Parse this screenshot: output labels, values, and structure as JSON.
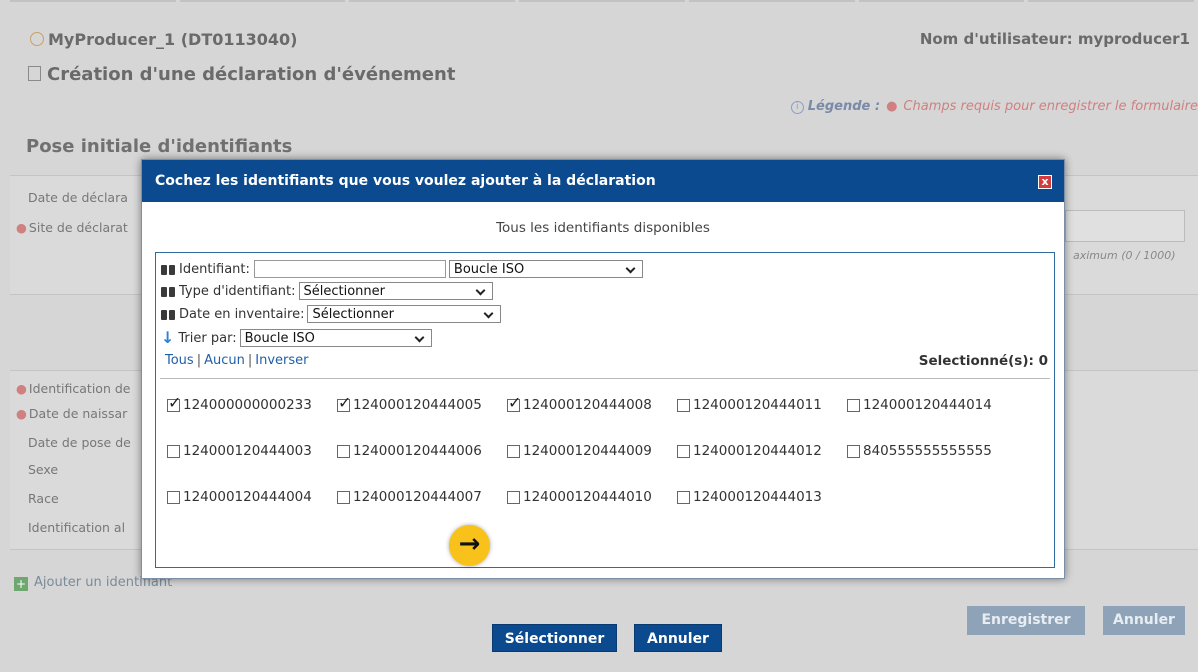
{
  "header": {
    "producer": "MyProducer_1 (DT0113040)",
    "username": "Nom d'utilisateur: myproducer1",
    "page_title": "Création d'une déclaration d'événement",
    "legend_label": "Légende :",
    "legend_dot": "●",
    "legend_text": "Champs requis pour enregistrer le formulaire"
  },
  "form": {
    "section_title": "Pose initiale d'identifiants",
    "labels": [
      "Date de déclara",
      "Site de déclarat",
      "Identification de",
      "Date de naissar",
      "Date de pose de",
      "Sexe",
      "Race",
      "Identification al"
    ],
    "counter": "aximum (0 / 1000)",
    "add_identifier": "Ajouter un identifiant",
    "save_label": "Enregistrer",
    "cancel_label": "Annuler"
  },
  "modal": {
    "title": "Cochez les identifiants que vous voulez ajouter à la déclaration",
    "close_label": "x",
    "subtitle": "Tous les identifiants disponibles",
    "filters": {
      "identifiant_label": "Identifiant:",
      "identifiant_value": "",
      "identifiant_type_select": "Boucle ISO",
      "type_label": "Type d'identifiant:",
      "type_select": "Sélectionner",
      "date_label": "Date en inventaire:",
      "date_select": "Sélectionner",
      "sort_label": "Trier par:",
      "sort_select": "Boucle ISO"
    },
    "links": {
      "all": "Tous",
      "none": "Aucun",
      "invert": "Inverser",
      "sep": "|"
    },
    "selected_count": "Selectionné(s): 0",
    "identifiers": [
      {
        "id": "124000000000233",
        "checked": true
      },
      {
        "id": "124000120444005",
        "checked": true
      },
      {
        "id": "124000120444008",
        "checked": true
      },
      {
        "id": "124000120444011",
        "checked": false
      },
      {
        "id": "124000120444014",
        "checked": false
      },
      {
        "id": "124000120444003",
        "checked": false
      },
      {
        "id": "124000120444006",
        "checked": false
      },
      {
        "id": "124000120444009",
        "checked": false
      },
      {
        "id": "124000120444012",
        "checked": false
      },
      {
        "id": "840555555555555",
        "checked": false
      },
      {
        "id": "124000120444004",
        "checked": false
      },
      {
        "id": "124000120444007",
        "checked": false
      },
      {
        "id": "124000120444010",
        "checked": false
      },
      {
        "id": "124000120444013",
        "checked": false
      }
    ],
    "select_button": "Sélectionner",
    "cancel_button": "Annuler"
  },
  "colors": {
    "header_blue": "#0b4a8f",
    "highlight": "#f8c21b",
    "required": "#d08080"
  }
}
